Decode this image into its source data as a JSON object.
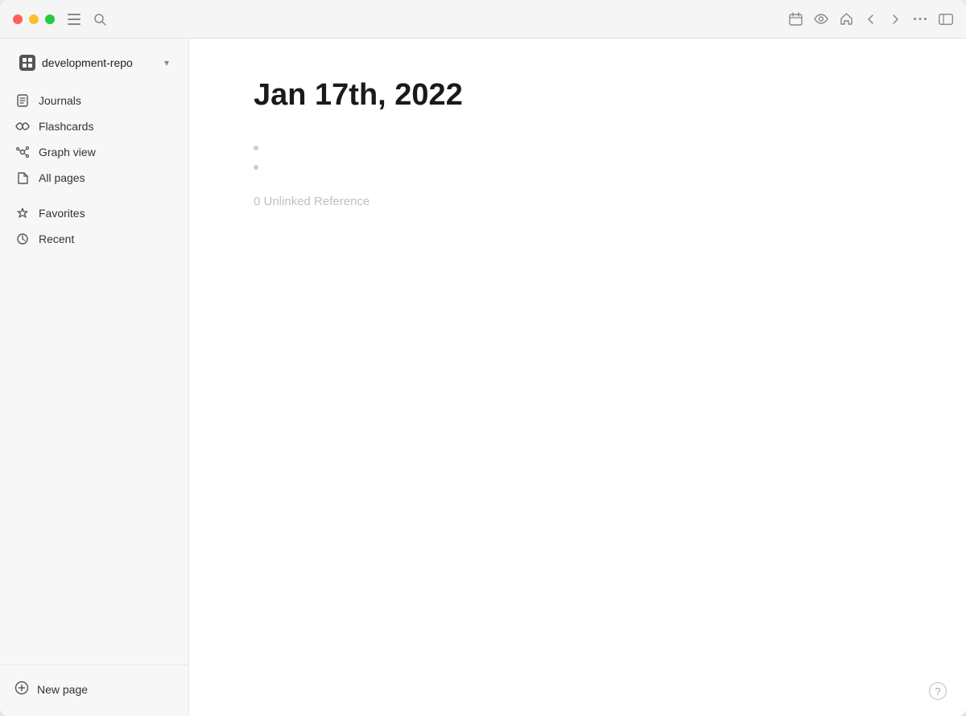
{
  "window": {
    "title": "development-repo"
  },
  "titlebar": {
    "hamburger_label": "☰",
    "search_label": "⌕",
    "calendar_label": "📅",
    "eye_label": "👁",
    "home_label": "⌂",
    "back_label": "←",
    "forward_label": "→",
    "more_label": "•••",
    "sidebar_toggle_label": "▤"
  },
  "sidebar": {
    "workspace": {
      "name": "development-repo",
      "chevron": "▾"
    },
    "nav_items": [
      {
        "id": "journals",
        "label": "Journals",
        "icon": "calendar"
      },
      {
        "id": "flashcards",
        "label": "Flashcards",
        "icon": "infinity"
      },
      {
        "id": "graph-view",
        "label": "Graph view",
        "icon": "graph"
      },
      {
        "id": "all-pages",
        "label": "All pages",
        "icon": "pages"
      }
    ],
    "section_items": [
      {
        "id": "favorites",
        "label": "Favorites",
        "icon": "star"
      },
      {
        "id": "recent",
        "label": "Recent",
        "icon": "clock"
      }
    ],
    "new_page": "New page"
  },
  "page": {
    "title": "Jan 17th, 2022",
    "bullet_items": [
      "",
      ""
    ],
    "unlinked_reference": "0 Unlinked Reference"
  },
  "help": {
    "label": "?"
  }
}
